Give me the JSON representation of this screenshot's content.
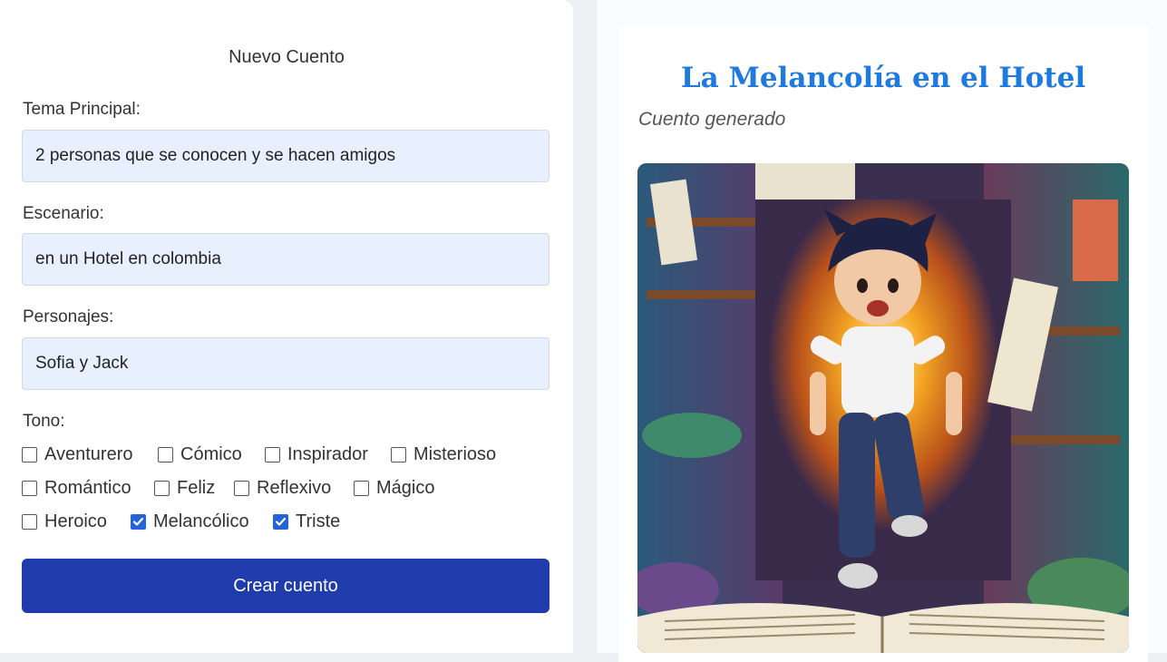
{
  "form": {
    "title": "Nuevo Cuento",
    "theme": {
      "label": "Tema Principal:",
      "value": "2 personas que se conocen y se hacen amigos"
    },
    "setting": {
      "label": "Escenario:",
      "value": "en un Hotel en colombia"
    },
    "characters": {
      "label": "Personajes:",
      "value": "Sofia y Jack"
    },
    "tone": {
      "label": "Tono:",
      "options": [
        {
          "label": "Aventurero",
          "checked": false
        },
        {
          "label": "Cómico",
          "checked": false
        },
        {
          "label": "Inspirador",
          "checked": false
        },
        {
          "label": "Misterioso",
          "checked": false
        },
        {
          "label": "Romántico",
          "checked": false
        },
        {
          "label": "Feliz",
          "checked": false
        },
        {
          "label": "Reflexivo",
          "checked": false
        },
        {
          "label": "Mágico",
          "checked": false
        },
        {
          "label": "Heroico",
          "checked": false
        },
        {
          "label": "Melancólico",
          "checked": true
        },
        {
          "label": "Triste",
          "checked": true
        }
      ]
    },
    "submit_label": "Crear cuento"
  },
  "story": {
    "title": "La Melancolía en el Hotel",
    "subtitle": "Cuento generado"
  },
  "colors": {
    "accent": "#1f3bac",
    "title": "#1f7ae0",
    "input_bg": "#e8f0fe",
    "checkbox": "#2563d8"
  }
}
